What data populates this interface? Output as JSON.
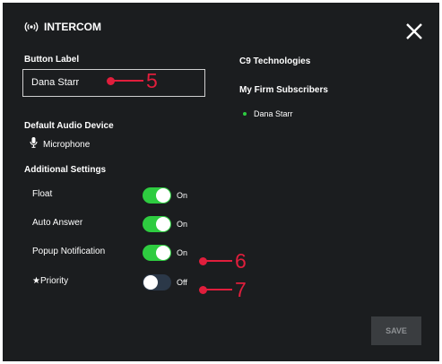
{
  "header": {
    "title": "INTERCOM",
    "icon": "broadcast-icon",
    "close_icon": "close-icon"
  },
  "button_label": {
    "heading": "Button Label",
    "value": "Dana Starr"
  },
  "audio": {
    "heading": "Default Audio Device",
    "icon": "microphone-icon",
    "device": "Microphone"
  },
  "additional": {
    "heading": "Additional Settings",
    "settings": [
      {
        "label": "Float",
        "state": "On",
        "on": true
      },
      {
        "label": "Auto Answer",
        "state": "On",
        "on": true
      },
      {
        "label": "Popup Notification",
        "state": "On",
        "on": true
      },
      {
        "label": "★Priority",
        "state": "Off",
        "on": false
      }
    ]
  },
  "right_panel": {
    "company": "C9 Technologies",
    "group_heading": "My Firm Subscribers",
    "subscribers": [
      "Dana Starr"
    ]
  },
  "annotations": {
    "input_marker": "5",
    "popup_marker": "6",
    "priority_marker": "7"
  },
  "save": {
    "label": "SAVE"
  },
  "colors": {
    "panel_bg": "#1b1d1f",
    "toggle_on": "#2ecc40",
    "toggle_off": "#2b3848",
    "annotation": "#e01e3c",
    "save_bg": "#3a3d40"
  }
}
